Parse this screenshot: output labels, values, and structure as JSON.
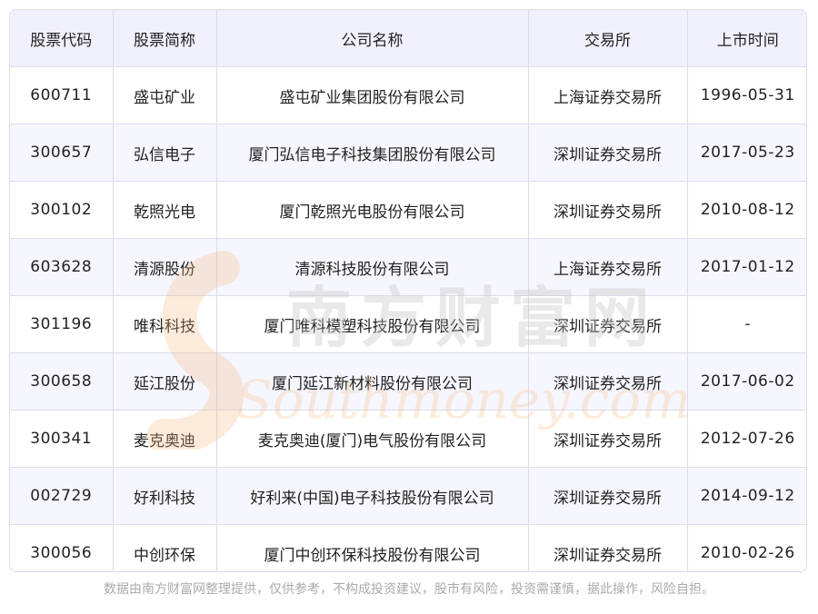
{
  "table": {
    "headers": [
      "股票代码",
      "股票简称",
      "公司名称",
      "交易所",
      "上市时间"
    ],
    "rows": [
      [
        "600711",
        "盛屯矿业",
        "盛屯矿业集团股份有限公司",
        "上海证券交易所",
        "1996-05-31"
      ],
      [
        "300657",
        "弘信电子",
        "厦门弘信电子科技集团股份有限公司",
        "深圳证券交易所",
        "2017-05-23"
      ],
      [
        "300102",
        "乾照光电",
        "厦门乾照光电股份有限公司",
        "深圳证券交易所",
        "2010-08-12"
      ],
      [
        "603628",
        "清源股份",
        "清源科技股份有限公司",
        "上海证券交易所",
        "2017-01-12"
      ],
      [
        "301196",
        "唯科科技",
        "厦门唯科模塑科技股份有限公司",
        "深圳证券交易所",
        "-"
      ],
      [
        "300658",
        "延江股份",
        "厦门延江新材料股份有限公司",
        "深圳证券交易所",
        "2017-06-02"
      ],
      [
        "300341",
        "麦克奥迪",
        "麦克奥迪(厦门)电气股份有限公司",
        "深圳证券交易所",
        "2012-07-26"
      ],
      [
        "002729",
        "好利科技",
        "好利来(中国)电子科技股份有限公司",
        "深圳证券交易所",
        "2014-09-12"
      ],
      [
        "300056",
        "中创环保",
        "厦门中创环保科技股份有限公司",
        "深圳证券交易所",
        "2010-02-26"
      ]
    ]
  },
  "watermark": {
    "cn": "南方财富网",
    "en": "Southmoney.com"
  },
  "footer": {
    "disclaimer": "数据由南方财富网整理提供，仅供参考，不构成投资建议，股市有风险，投资需谨慎，据此操作，风险自担。"
  }
}
